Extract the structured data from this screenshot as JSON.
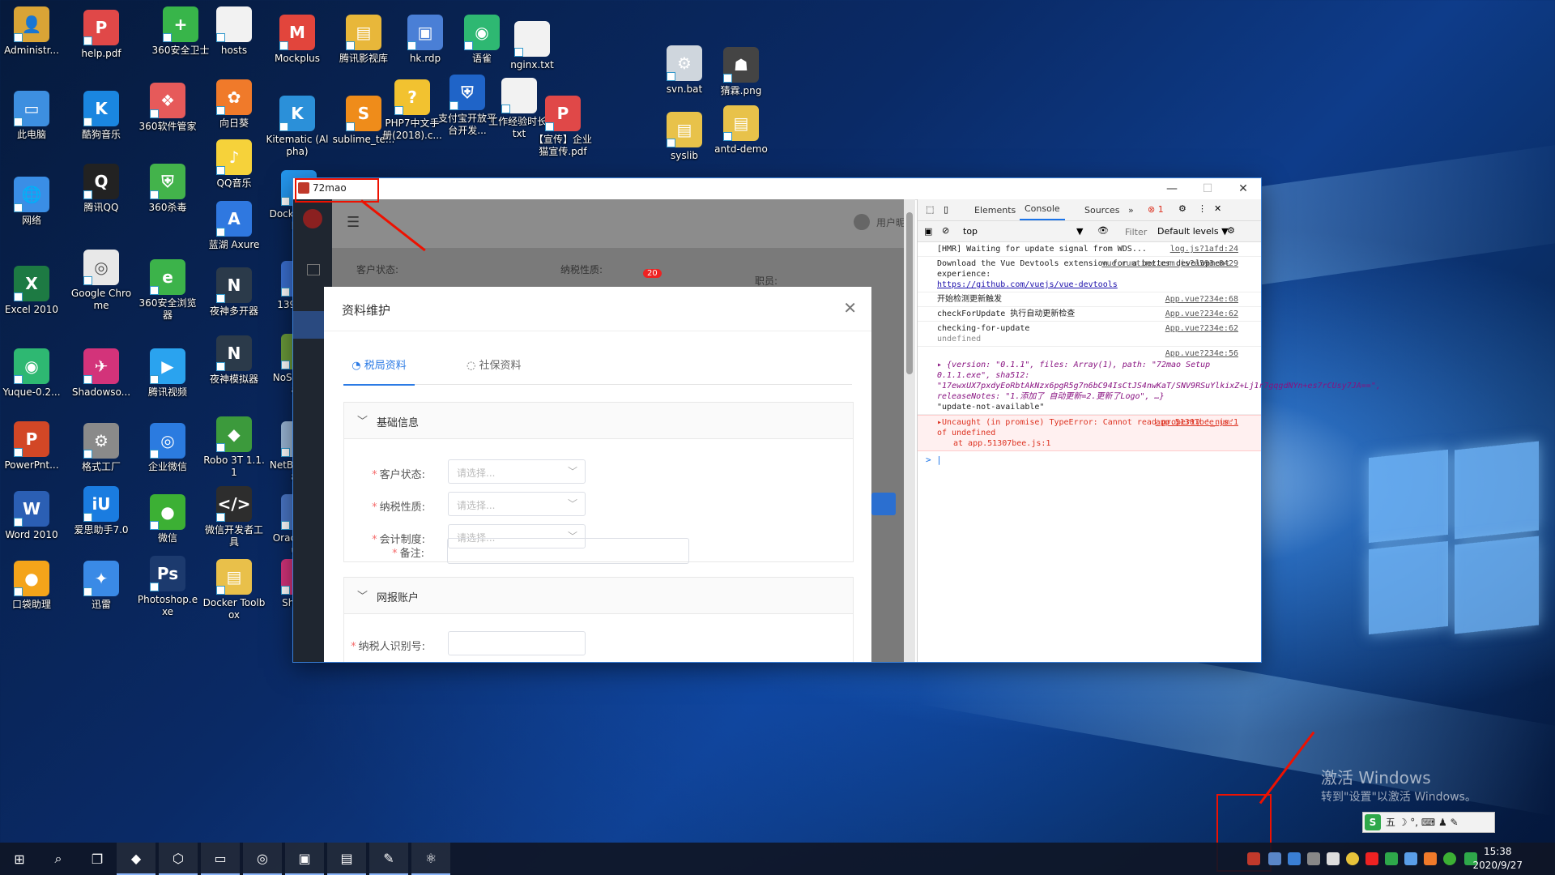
{
  "desktop": {
    "icons": [
      {
        "label": "Administr...",
        "color": "#d9a436",
        "glyph": "👤"
      },
      {
        "label": "help.pdf",
        "color": "#e04848",
        "glyph": "P"
      },
      {
        "label": "360安全卫士",
        "color": "#38b54a",
        "glyph": "+"
      },
      {
        "label": "hosts",
        "color": "#f2f2f2",
        "glyph": ""
      },
      {
        "label": "Mockplus",
        "color": "#e2453c",
        "glyph": "M"
      },
      {
        "label": "腾讯影视库",
        "color": "#e8b73a",
        "glyph": "▤"
      },
      {
        "label": "hk.rdp",
        "color": "#4a7fd6",
        "glyph": "▣"
      },
      {
        "label": "语雀",
        "color": "#2eb872",
        "glyph": "◉"
      },
      {
        "label": "nginx.txt",
        "color": "#f2f2f2",
        "glyph": ""
      },
      {
        "label": "此电脑",
        "color": "#3d8fe0",
        "glyph": "▭"
      },
      {
        "label": "酷狗音乐",
        "color": "#1a86e0",
        "glyph": "K"
      },
      {
        "label": "360软件管家",
        "color": "#e65a5a",
        "glyph": "❖"
      },
      {
        "label": "向日葵",
        "color": "#f07a2a",
        "glyph": "✿"
      },
      {
        "label": "Kitematic (Alpha)",
        "color": "#2b90d9",
        "glyph": "K"
      },
      {
        "label": "sublime_te...",
        "color": "#ef8c1a",
        "glyph": "S"
      },
      {
        "label": "PHP7中文手册(2018).c...",
        "color": "#f2c230",
        "glyph": "?"
      },
      {
        "label": "支付宝开放平台开发...",
        "color": "#1f64c8",
        "glyph": "⛨"
      },
      {
        "label": "工作经验时长.txt",
        "color": "#f2f2f2",
        "glyph": ""
      },
      {
        "label": "【宣传】企业猫宣传.pdf",
        "color": "#e04848",
        "glyph": "P"
      },
      {
        "label": "网络",
        "color": "#3a8ee6",
        "glyph": "🌐"
      },
      {
        "label": "腾讯QQ",
        "color": "#222",
        "glyph": "Q"
      },
      {
        "label": "360杀毒",
        "color": "#43b34b",
        "glyph": "⛨"
      },
      {
        "label": "QQ音乐",
        "color": "#f6d23a",
        "glyph": "♪"
      },
      {
        "label": "蓝湖 Axure",
        "color": "#2f78e0",
        "glyph": "A"
      },
      {
        "label": "Docker Quick...",
        "color": "#2496ed",
        "glyph": "D"
      },
      {
        "label": "Excel 2010",
        "color": "#1d7a43",
        "glyph": "X"
      },
      {
        "label": "Google Chrome",
        "color": "#e8e8e8",
        "glyph": "◎"
      },
      {
        "label": "360安全浏览器",
        "color": "#3cb34a",
        "glyph": "e"
      },
      {
        "label": "夜神多开器",
        "color": "#2b3a4a",
        "glyph": "N"
      },
      {
        "label": "139.15...",
        "color": "#3a6fd0",
        "glyph": "▣"
      },
      {
        "label": "Yuque-0.2...",
        "color": "#2eb872",
        "glyph": "◉"
      },
      {
        "label": "Shadowso...",
        "color": "#d3337a",
        "glyph": "✈"
      },
      {
        "label": "腾讯视频",
        "color": "#2aa3ef",
        "glyph": "▶"
      },
      {
        "label": "夜神模拟器",
        "color": "#2b3a4a",
        "glyph": "N"
      },
      {
        "label": "NoS... Mana...",
        "color": "#6a9a3a",
        "glyph": "≡"
      },
      {
        "label": "PowerPnt...",
        "color": "#d24726",
        "glyph": "P"
      },
      {
        "label": "格式工厂",
        "color": "#8a8a8a",
        "glyph": "⚙"
      },
      {
        "label": "企业微信",
        "color": "#2b7be0",
        "glyph": "◎"
      },
      {
        "label": "Robo 3T 1.1.1",
        "color": "#3c9a3c",
        "glyph": "◆"
      },
      {
        "label": "NetBe... IDE 8...",
        "color": "#9ab6d6",
        "glyph": "▦"
      },
      {
        "label": "Word 2010",
        "color": "#2b5fb4",
        "glyph": "W"
      },
      {
        "label": "爱思助手7.0",
        "color": "#1a7ce0",
        "glyph": "iU"
      },
      {
        "label": "微信",
        "color": "#3cb034",
        "glyph": "●"
      },
      {
        "label": "微信开发者工具",
        "color": "#2d2d2d",
        "glyph": "</>"
      },
      {
        "label": "Orac... Virtu...",
        "color": "#4a76c6",
        "glyph": "▢"
      },
      {
        "label": "口袋助理",
        "color": "#f4a41a",
        "glyph": "●"
      },
      {
        "label": "迅雷",
        "color": "#3a8ae6",
        "glyph": "✦"
      },
      {
        "label": "Photoshop.exe",
        "color": "#1c3a6e",
        "glyph": "Ps"
      },
      {
        "label": "Docker Toolbox",
        "color": "#e9c04a",
        "glyph": "▤"
      },
      {
        "label": "Shad...",
        "color": "#d3337a",
        "glyph": "✈"
      },
      {
        "label": "svn.bat",
        "color": "#cfd6dd",
        "glyph": "⚙"
      },
      {
        "label": "猜霖.png",
        "color": "#444",
        "glyph": "☗"
      },
      {
        "label": "syslib",
        "color": "#e8c24a",
        "glyph": "▤"
      },
      {
        "label": "antd-demo",
        "color": "#e8c24a",
        "glyph": "▤"
      }
    ]
  },
  "window": {
    "title": "72mao",
    "minimize": "—",
    "maximize": "☐",
    "close": "✕"
  },
  "app": {
    "header_user": "用户昵称",
    "bg_labels": {
      "customer": "客户状态:",
      "tax": "纳税性质:",
      "staff": "职员:",
      "badge": "20"
    },
    "modal": {
      "title": "资料维护",
      "close": "✕",
      "tabs": [
        {
          "label": "税局资料",
          "icon": "◔"
        },
        {
          "label": "社保资料",
          "icon": "◌"
        }
      ],
      "section1": {
        "title": "基础信息",
        "toggle": "﹀"
      },
      "fields": [
        {
          "label": "客户状态:",
          "placeholder": "请选择..."
        },
        {
          "label": "纳税性质:",
          "placeholder": "请选择..."
        },
        {
          "label": "会计制度:",
          "placeholder": "请选择..."
        },
        {
          "label": "备注:",
          "placeholder": ""
        }
      ],
      "section2": {
        "title": "网报账户",
        "toggle": "﹀"
      },
      "partial_field": "纳税人识别号:"
    }
  },
  "devtools": {
    "tabs": [
      "Elements",
      "Console",
      "Sources",
      "»"
    ],
    "error_count": "1",
    "context": "top",
    "filter_placeholder": "Filter",
    "levels": "Default levels ▼",
    "messages": [
      {
        "text": "[HMR] Waiting for update signal from WDS...",
        "src": "log.js?1afd:24",
        "type": "log"
      },
      {
        "text": "Download the Vue Devtools extension for a better development experience:",
        "link": "https://github.com/vuejs/vue-devtools",
        "src": "vue.runtime.esm.js?a593:8429",
        "type": "log"
      },
      {
        "text": "开始检测更新触发",
        "src": "App.vue?234e:68",
        "type": "log"
      },
      {
        "text": "checkForUpdate 执行自动更新检查",
        "src": "App.vue?234e:62",
        "type": "log"
      },
      {
        "text": "checking-for-update",
        "extra": "undefined",
        "src": "App.vue?234e:62",
        "type": "log"
      },
      {
        "text": "▸ {version: \"0.1.1\", files: Array(1), path: \"72mao Setup 0.1.1.exe\", sha512: \"17ewxUX7pxdyEoRbtAkNzx6pgR5g7n6bC94IsCtJS4nwKaT/SNV9RSuYlkixZ+Lj1r7gqgdNYn+es7rCUsy7JA==\", releaseNotes: \"1.添加了 自动更新=2.更新了Logo\", …}",
        "extra2": "\"update-not-available\"",
        "src": "App.vue?234e:56",
        "type": "obj"
      },
      {
        "text": "▸Uncaught (in promise) TypeError: Cannot read property '_num' of undefined",
        "extra": "at app.51307bee.js:1",
        "src": "app.51307bee.js:1",
        "type": "err"
      }
    ],
    "prompt": ">"
  },
  "activation": {
    "title": "激活 Windows",
    "subtitle": "转到\"设置\"以激活 Windows。"
  },
  "ime_bar": "五 ☽ °, ⌨ ♟ ✎",
  "taskbar": {
    "time": "15:38",
    "date": "2020/9/27"
  }
}
